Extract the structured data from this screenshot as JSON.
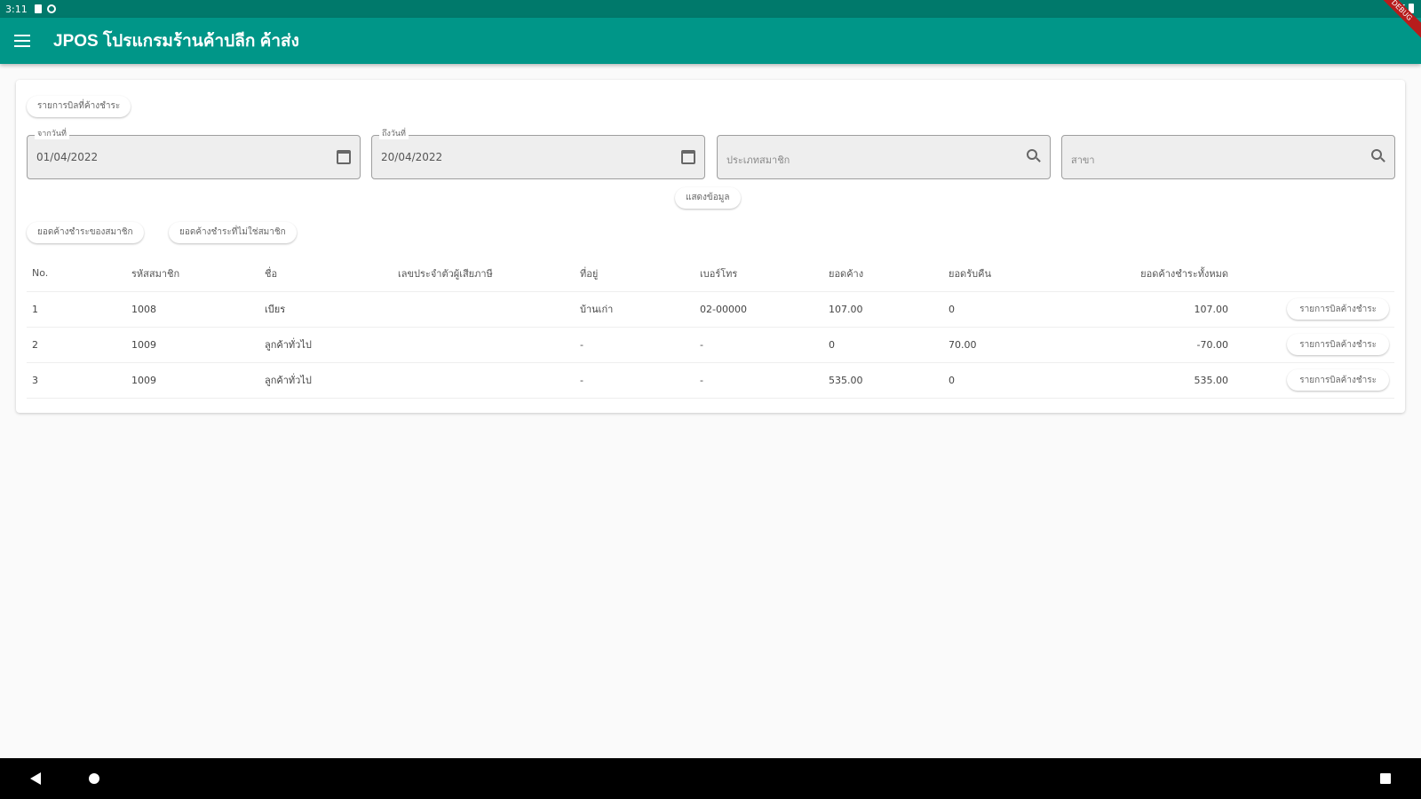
{
  "status_bar": {
    "time": "3:11",
    "icons": [
      "sd-card-icon",
      "sync-icon"
    ]
  },
  "debug_banner": "DEBUG",
  "app_bar": {
    "title": "JPOS โปรแกรมร้านค้าปลีก ค้าส่ง"
  },
  "top_button": {
    "label": "รายการบิลที่ค้างชำระ"
  },
  "filters": {
    "start_date": {
      "label": "จากวันที่",
      "value": "01/04/2022"
    },
    "end_date": {
      "label": "ถึงวันที่",
      "value": "20/04/2022"
    },
    "member_search": {
      "placeholder": "ประเภทสมาชิก"
    },
    "branch_search": {
      "placeholder": "สาขา"
    }
  },
  "show_button": {
    "label": "แสดงข้อมูล"
  },
  "tabs": [
    {
      "label": "ยอดค้างชำระของสมาชิก"
    },
    {
      "label": "ยอดค้างชำระที่ไม่ใช่สมาชิก"
    }
  ],
  "table": {
    "headers": [
      "No.",
      "รหัสสมาชิก",
      "ชื่อ",
      "เลขประจำตัวผู้เสียภาษี",
      "ที่อยู่",
      "เบอร์โทร",
      "ยอดค้าง",
      "ยอดรับคืน",
      "ยอดค้างชำระทั้งหมด"
    ],
    "rows": [
      {
        "no": "1",
        "code": "1008",
        "name": "เบียร",
        "tax_id": "",
        "address": "บ้านเก่า",
        "phone": "02-00000",
        "owed": "107.00",
        "returned": "0",
        "total": "107.00",
        "action": "รายการบิลค้างชำระ"
      },
      {
        "no": "2",
        "code": "1009",
        "name": "ลูกค้าทั่วไป",
        "tax_id": "",
        "address": "-",
        "phone": "-",
        "owed": "0",
        "returned": "70.00",
        "total": "-70.00",
        "action": "รายการบิลค้างชำระ"
      },
      {
        "no": "3",
        "code": "1009",
        "name": "ลูกค้าทั่วไป",
        "tax_id": "",
        "address": "-",
        "phone": "-",
        "owed": "535.00",
        "returned": "0",
        "total": "535.00",
        "action": "รายการบิลค้างชำระ"
      }
    ]
  },
  "colors": {
    "app_bar": "#009688",
    "status_bar": "#00796b",
    "background": "#fafafa"
  }
}
